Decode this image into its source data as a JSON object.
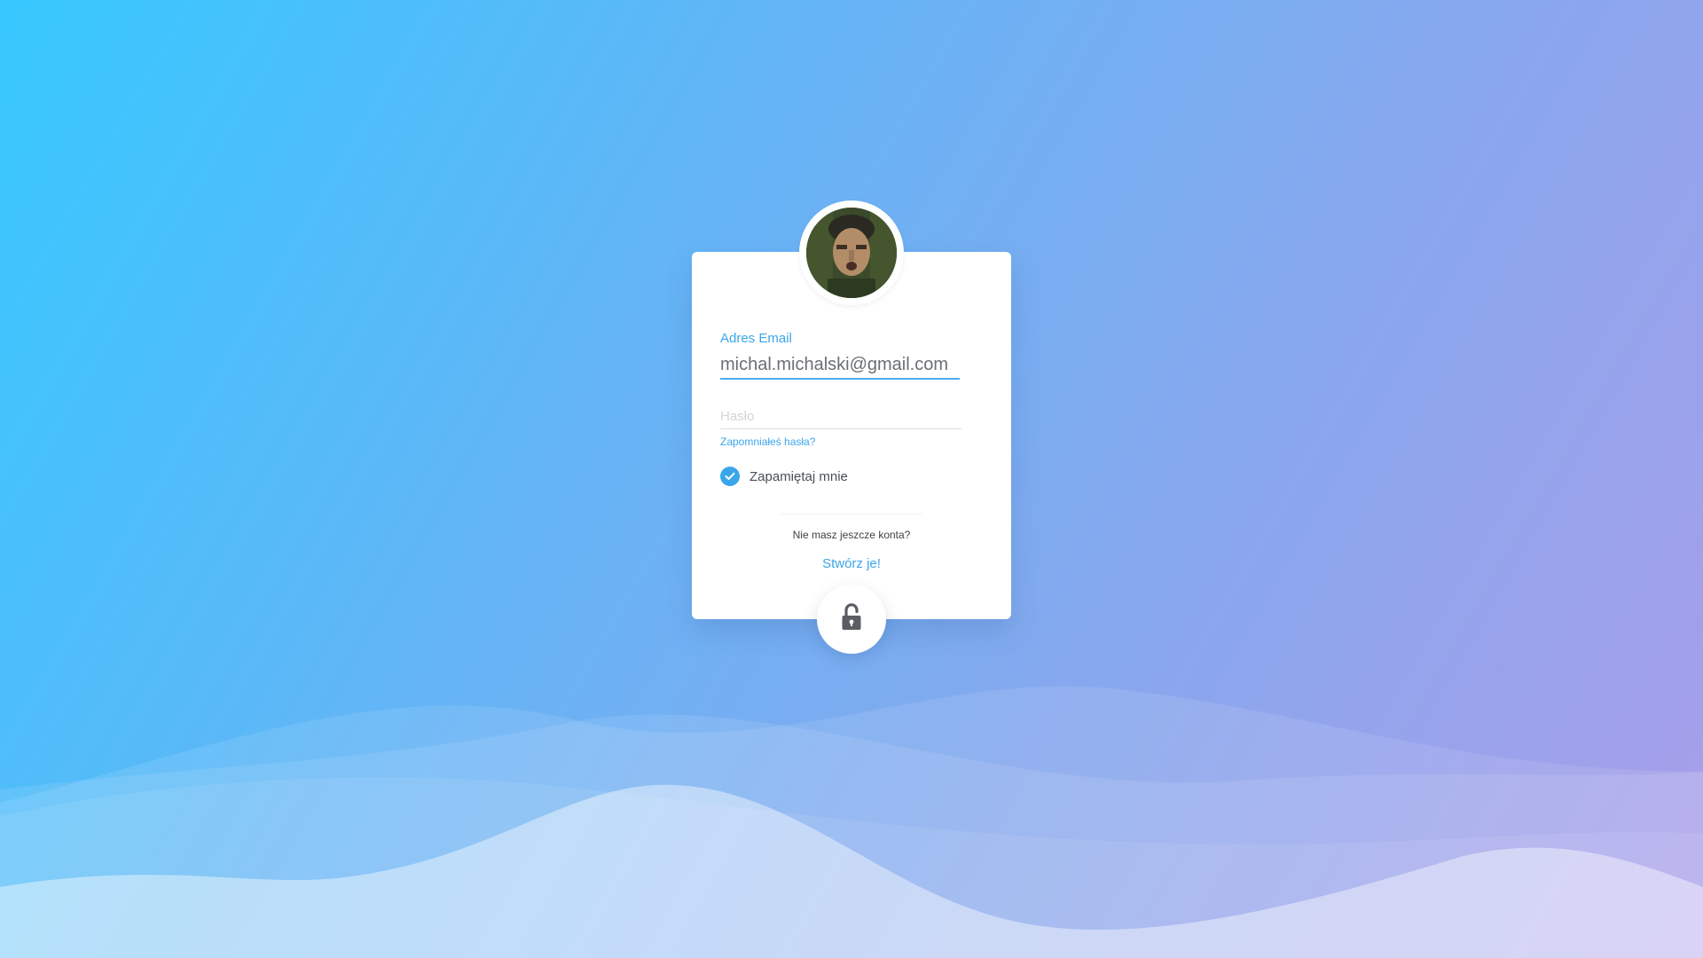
{
  "login": {
    "email_label": "Adres Email",
    "email_value": "michal.michalski@gmail.com",
    "password_placeholder": "Hasło",
    "forgot_password": "Zapomniałeś hasła?",
    "remember_me": "Zapamiętaj mnie",
    "remember_checked": true,
    "no_account_text": "Nie masz jeszcze konta?",
    "create_account": "Stwórz je!"
  },
  "icons": {
    "avatar": "user-avatar",
    "check": "check-icon",
    "submit": "unlock-icon"
  },
  "colors": {
    "accent": "#3aa6ea",
    "background_start": "#37c8ff",
    "background_end": "#a99ee9",
    "icon": "#5a5d63"
  }
}
